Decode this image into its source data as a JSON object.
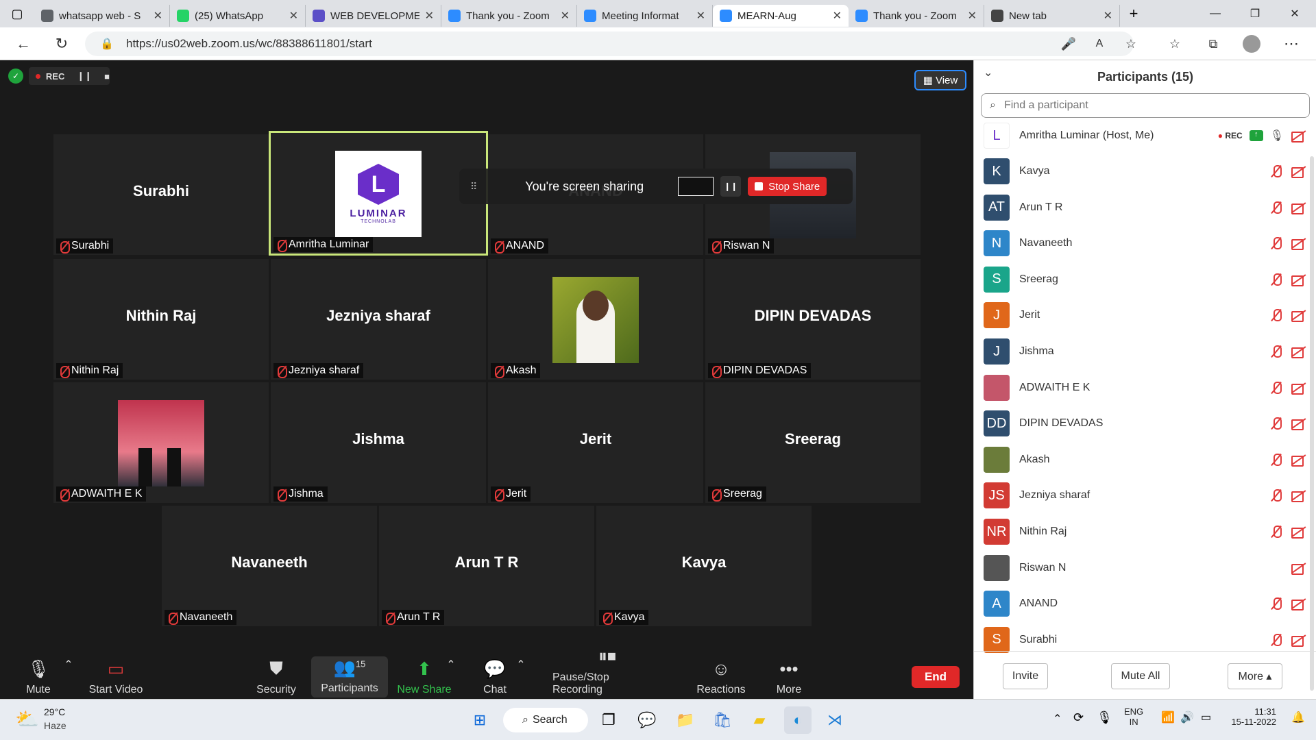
{
  "browser": {
    "tabs": [
      {
        "title": "whatsapp web - S",
        "color": "#5f6368"
      },
      {
        "title": "(25) WhatsApp",
        "color": "#25d366",
        "badge": "25"
      },
      {
        "title": "WEB DEVELOPME",
        "color": "#5b4fc7"
      },
      {
        "title": "Thank you - Zoom",
        "color": "#2d8cff"
      },
      {
        "title": "Meeting Informat",
        "color": "#2d8cff"
      },
      {
        "title": "MEARN-Aug",
        "color": "#2d8cff",
        "active": true
      },
      {
        "title": "Thank you - Zoom",
        "color": "#2d8cff"
      },
      {
        "title": "New tab",
        "color": "#444"
      }
    ],
    "url": "https://us02web.zoom.us/wc/88388611801/start"
  },
  "meeting": {
    "rec_label": "REC",
    "view_label": "View",
    "share_banner": {
      "text": "You're screen sharing",
      "stop_label": "Stop Share"
    },
    "tiles": [
      {
        "name": "Surabhi",
        "label": "Surabhi"
      },
      {
        "name": "",
        "label": "Amritha Luminar",
        "logo": "LUMINAR",
        "logo_sub": "TECHNOLAB"
      },
      {
        "name": "ANAND",
        "label": "ANAND"
      },
      {
        "name": "",
        "label": "Riswan N"
      },
      {
        "name": "Nithin Raj",
        "label": "Nithin Raj"
      },
      {
        "name": "Jezniya sharaf",
        "label": "Jezniya sharaf"
      },
      {
        "name": "",
        "label": "Akash"
      },
      {
        "name": "DIPIN DEVADAS",
        "label": "DIPIN DEVADAS"
      },
      {
        "name": "",
        "label": "ADWAITH E K"
      },
      {
        "name": "Jishma",
        "label": "Jishma"
      },
      {
        "name": "Jerit",
        "label": "Jerit"
      },
      {
        "name": "Sreerag",
        "label": "Sreerag"
      },
      {
        "name": "Navaneeth",
        "label": "Navaneeth"
      },
      {
        "name": "Arun T R",
        "label": "Arun T R"
      },
      {
        "name": "Kavya",
        "label": "Kavya"
      }
    ]
  },
  "toolbar": {
    "mute": "Mute",
    "start_video": "Start Video",
    "security": "Security",
    "participants": "Participants",
    "participants_count": "15",
    "new_share": "New Share",
    "chat": "Chat",
    "pause_stop": "Pause/Stop Recording",
    "reactions": "Reactions",
    "more": "More",
    "end": "End"
  },
  "panel": {
    "title": "Participants (15)",
    "search_placeholder": "Find a participant",
    "host": "Amritha Luminar (Host, Me)",
    "host_rec": "REC",
    "participants": [
      {
        "initials": "K",
        "name": "Kavya",
        "color": "#2f4e6e"
      },
      {
        "initials": "AT",
        "name": "Arun T R",
        "color": "#2f4e6e"
      },
      {
        "initials": "N",
        "name": "Navaneeth",
        "color": "#2e86c9"
      },
      {
        "initials": "S",
        "name": "Sreerag",
        "color": "#1aa58a"
      },
      {
        "initials": "J",
        "name": "Jerit",
        "color": "#e0671a"
      },
      {
        "initials": "J",
        "name": "Jishma",
        "color": "#2f4e6e"
      },
      {
        "initials": "",
        "name": "ADWAITH E K",
        "color": "#c4566a"
      },
      {
        "initials": "DD",
        "name": "DIPIN DEVADAS",
        "color": "#2f4e6e"
      },
      {
        "initials": "",
        "name": "Akash",
        "color": "#6b7c3a"
      },
      {
        "initials": "JS",
        "name": "Jezniya sharaf",
        "color": "#d23b33"
      },
      {
        "initials": "NR",
        "name": "Nithin Raj",
        "color": "#d23b33"
      },
      {
        "initials": "",
        "name": "Riswan N",
        "color": "#555"
      },
      {
        "initials": "A",
        "name": "ANAND",
        "color": "#2e86c9"
      },
      {
        "initials": "S",
        "name": "Surabhi",
        "color": "#e0671a"
      }
    ],
    "invite": "Invite",
    "mute_all": "Mute All",
    "more": "More ▴"
  },
  "taskbar": {
    "temp": "29°C",
    "weather": "Haze",
    "search": "Search",
    "lang": "ENG",
    "region": "IN",
    "time": "11:31",
    "date": "15-11-2022"
  }
}
